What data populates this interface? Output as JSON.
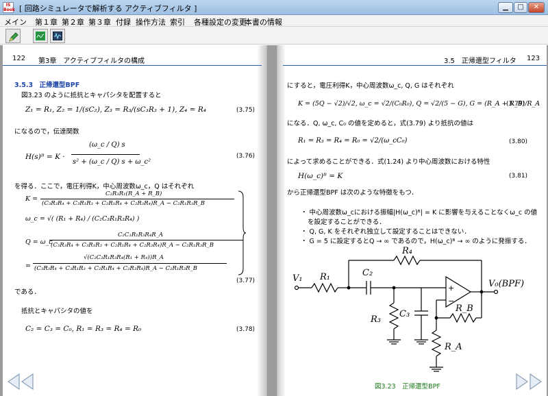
{
  "window": {
    "app_icon_text": "IS\nBook",
    "title": "[ 回路シミュレータで解析する アクティブフィルタ ]",
    "min": "▁",
    "max": "□",
    "close": "✕"
  },
  "menu": {
    "items": [
      "メイン",
      "第１章",
      "第２章",
      "第３章",
      "付録",
      "操作方法",
      "索引",
      "各種設定の変更",
      "本書の情報"
    ]
  },
  "left_page": {
    "page_number": "122",
    "chapter_title": "第3章　アクティブフィルタの構成",
    "section_heading": "3.5.3　正帰還型BPF",
    "p1": "図3.23 のように抵抗とキャパシタを配置すると",
    "eq_375": "Z₁ = R₁,  Z₂ = 1/(sC₂),  Z₃ = R₃/(sC₃R₃ + 1),  Z₄ = R₄",
    "eq_375_no": "(3.75)",
    "p2": "になるので，伝達関数",
    "eq_376_lhs": "H(s)ᴮ = K ·",
    "eq_376_num": "(ω_c / Q) s",
    "eq_376_den": "s² + (ω_c / Q) s + ω_c²",
    "eq_376_no": "(3.76)",
    "p3": "を得る．ここで，電圧利得K，中心周波数ω_c，Q はそれぞれ",
    "eq_377_K_lhs": "K =",
    "eq_377_K_num": "C₂R₃R₁(R_A + R_B)",
    "eq_377_K_den": "(C₃R₃R₄ + C₃R₁R₃ + C₂R₁R₄ + C₂R₃R₄)R_A − C₂R₁R₃R_B",
    "eq_377_w": "ω_c = √( (R₁ + R₄) / (C₂C₃R₁R₃R₄) )",
    "eq_377_Q_lhs": "Q = ω_c",
    "eq_377_Q_num": "C₂C₃R₁R₃R₄R_A",
    "eq_377_Q_den": "(C₃R₃R₄ + C₃R₁R₃ + C₂R₁R₄ + C₂R₃R₄)R_A − C₂R₁R₃R_B",
    "eq_377_eq_lhs": "=",
    "eq_377_eq_num": "√(C₂C₃R₁R₃R₄(R₁ + R₄))R_A",
    "eq_377_eq_den": "(C₃R₃R₄ + C₃R₁R₃ + C₂R₁R₄ + C₂R₃R₄)R_A − C₂R₁R₃R_B",
    "eq_377_no": "(3.77)",
    "p4": "である．",
    "p5": "抵抗とキャパシタの値を",
    "eq_378": "C₂ = C₃ = C₀,  R₁ = R₃ = R₄ = R₀",
    "eq_378_no": "(3.78)"
  },
  "right_page": {
    "page_number": "123",
    "chapter_title": "3.5　正帰還型フィルタ",
    "p1": "にすると，電圧利得K，中心周波数ω_c, Q, G はそれぞれ",
    "eq_379": "K = (5Q − √2)/√2,   ω_c = √2/(C₀R₀),   Q = √2/(5 − G),   G = (R_A + R_B)/R_A",
    "eq_379_no": "(3.79)",
    "p2": "になる．Q, ω_c, C₀ の値を定めると，式(3.79) より抵抗の値は",
    "eq_380": "R₁ = R₃ = R₄ = R₀ = √2/(ω_cC₀)",
    "eq_380_no": "(3.80)",
    "p3": "によって求めることができる．式(1.24) より中心周波数における特性",
    "eq_381": "H(ω_c)ᴮ = K",
    "eq_381_no": "(3.81)",
    "p4": "から正帰還型BPF は次のような特徴をもつ．",
    "bullets": [
      "中心周波数ω_cにおける振幅|H(ω_c)ᴮ| = K に影響を与えることなくω_c の値",
      "を設定することができる．",
      "Q, G, K をそれぞれ独立して設定することはできない．",
      "G = 5 に設定するとQ → ∞ であるので，H(ω_c)ᴮ → ∞ のように発振する．"
    ],
    "circuit_labels": {
      "v1": "V₁",
      "r1": "R₁",
      "c2": "C₂",
      "r4": "R₄",
      "r3": "R₃",
      "c3": "C₃",
      "rb": "R_B",
      "ra": "R_A",
      "vo": "V₀(BPF)",
      "minus": "−",
      "plus": "+"
    },
    "figure_caption": "図3.23　正帰還型BPF"
  },
  "nav": {
    "prev": "◁◁",
    "next": "▷▷"
  },
  "colors": {
    "heading_blue": "#1d46a8",
    "rule_blue": "#2b5ca8",
    "caption_green": "#1b7a1b"
  }
}
